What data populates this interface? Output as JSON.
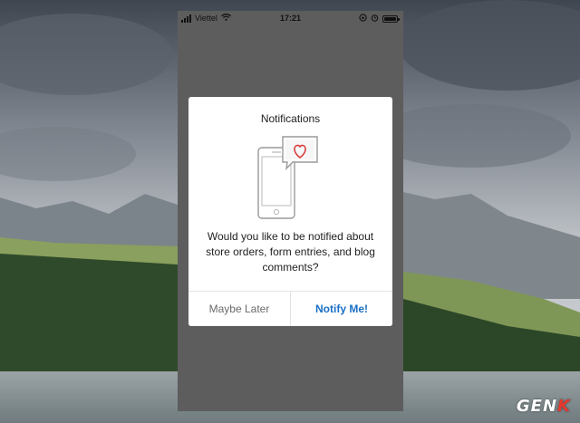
{
  "status_bar": {
    "carrier": "Viettel",
    "time": "17:21",
    "icons": [
      "signal-icon",
      "wifi-icon",
      "lock-rotation-icon",
      "alarm-icon",
      "battery-icon"
    ]
  },
  "dialog": {
    "title": "Notifications",
    "illustration": "phone-with-heart-message-icon",
    "message": "Would you like to be notified about store orders, form entries, and blog comments?",
    "buttons": {
      "later": "Maybe Later",
      "notify": "Notify Me!"
    }
  },
  "watermark": {
    "prefix": "GEN",
    "suffix": "K"
  },
  "colors": {
    "phone_screen": "#5d5d5d",
    "dialog_bg": "#ffffff",
    "primary_action": "#1a6fc4",
    "secondary_action": "#6b6b6b",
    "heart_accent": "#d83a3a"
  }
}
